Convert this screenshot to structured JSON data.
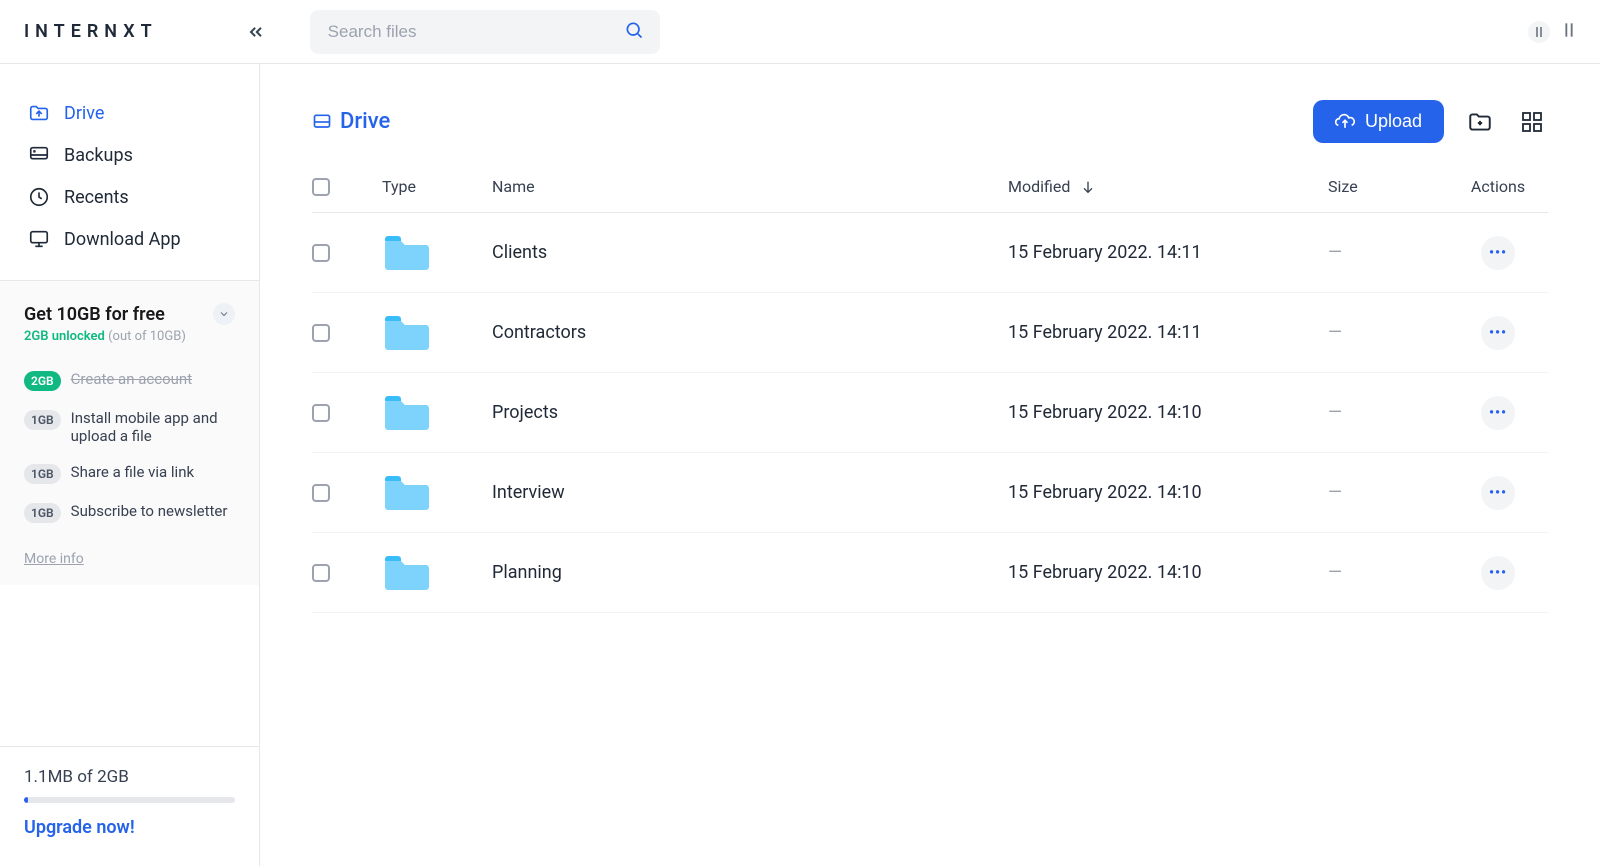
{
  "brand": "INTERNXT",
  "search": {
    "placeholder": "Search files"
  },
  "sidebar": {
    "items": [
      {
        "label": "Drive",
        "active": true
      },
      {
        "label": "Backups",
        "active": false
      },
      {
        "label": "Recents",
        "active": false
      },
      {
        "label": "Download App",
        "active": false
      }
    ]
  },
  "promo": {
    "title": "Get 10GB for free",
    "unlocked_text": "2GB unlocked",
    "out_of_text": " (out of 10GB)",
    "more_info": "More info",
    "tasks": [
      {
        "badge": "2GB",
        "text": "Create an account",
        "done": true,
        "badgeColor": "green"
      },
      {
        "badge": "1GB",
        "text": "Install mobile app and upload a file",
        "done": false,
        "badgeColor": "grey"
      },
      {
        "badge": "1GB",
        "text": "Share a file via link",
        "done": false,
        "badgeColor": "grey"
      },
      {
        "badge": "1GB",
        "text": "Subscribe to newsletter",
        "done": false,
        "badgeColor": "grey"
      }
    ]
  },
  "storage": {
    "usage_text": "1.1MB of 2GB",
    "upgrade_label": "Upgrade now!"
  },
  "breadcrumb": "Drive",
  "toolbar": {
    "upload_label": "Upload"
  },
  "columns": {
    "type": "Type",
    "name": "Name",
    "modified": "Modified",
    "size": "Size",
    "actions": "Actions"
  },
  "rows": [
    {
      "name": "Clients",
      "modified": "15 February 2022. 14:11",
      "size": "—"
    },
    {
      "name": "Contractors",
      "modified": "15 February 2022. 14:11",
      "size": "—"
    },
    {
      "name": "Projects",
      "modified": "15 February 2022. 14:10",
      "size": "—"
    },
    {
      "name": "Interview",
      "modified": "15 February 2022. 14:10",
      "size": "—"
    },
    {
      "name": "Planning",
      "modified": "15 February 2022. 14:10",
      "size": "—"
    }
  ]
}
